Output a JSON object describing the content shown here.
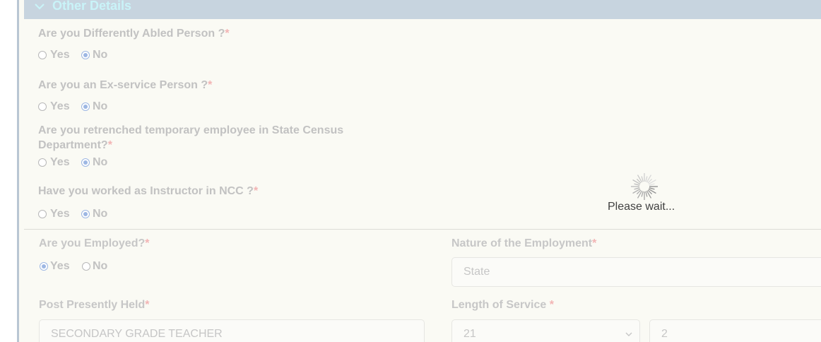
{
  "section": {
    "title": "Other Details"
  },
  "questions": [
    {
      "label": "Are you Differently Abled Person ?",
      "required": "*",
      "yes": "Yes",
      "no": "No",
      "selected": "No"
    },
    {
      "label": "Are you an Ex-service Person ?",
      "required": "*",
      "yes": "Yes",
      "no": "No",
      "selected": "No"
    },
    {
      "label_line1": "Are you retrenched temporary employee in State Census",
      "label_line2": "Department?",
      "required": "*",
      "yes": "Yes",
      "no": "No",
      "selected": "No"
    },
    {
      "label": "Have you worked as Instructor in NCC ?",
      "required": "*",
      "yes": "Yes",
      "no": "No",
      "selected": "No"
    }
  ],
  "employment": {
    "employed_label": "Are you Employed?",
    "employed_required": "*",
    "employed_yes": "Yes",
    "employed_no": "No",
    "employed_selected": "Yes",
    "nature_label": "Nature of the Employment",
    "nature_required": "*",
    "nature_value": "State",
    "post_label": "Post Presently Held",
    "post_required": "*",
    "post_value": "SECONDARY GRADE TEACHER",
    "length_label": "Length of Service ",
    "length_required": "*",
    "length_years": "21",
    "length_months": "2"
  },
  "overlay": {
    "text": "Please wait...",
    "icon": "spinner-icon"
  },
  "colors": {
    "header_bg": "#c7d4df",
    "header_text": "#c9f3f8",
    "panel_bg": "#fafaf4",
    "required": "#f2b4b4",
    "radio_checked": "#9db7e3"
  }
}
